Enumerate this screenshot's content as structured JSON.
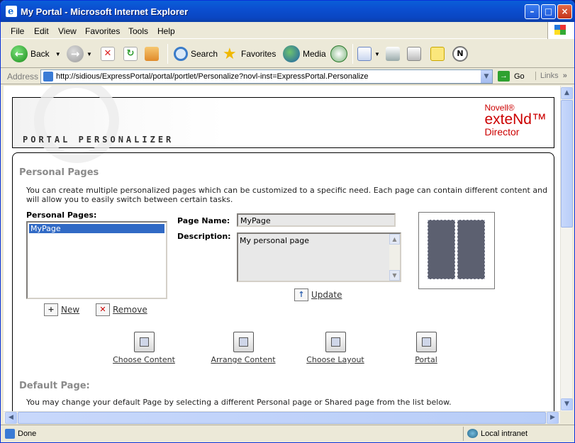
{
  "window": {
    "title": "My Portal - Microsoft Internet Explorer"
  },
  "menu": [
    "File",
    "Edit",
    "View",
    "Favorites",
    "Tools",
    "Help"
  ],
  "toolbar": {
    "back": "Back",
    "search": "Search",
    "favorites": "Favorites",
    "media": "Media"
  },
  "address": {
    "label": "Address",
    "url": "http://sidious/ExpressPortal/portal/portlet/Personalize?novl-inst=ExpressPortal.Personalize",
    "go": "Go",
    "links": "Links"
  },
  "banner": {
    "title": "PORTAL PERSONALIZER",
    "brand_line1": "Novell®",
    "brand_line2": "exteNd™",
    "brand_line3": "Director"
  },
  "personal": {
    "heading": "Personal Pages",
    "intro": "You can create multiple personalized pages which can be customized to a specific need. Each page can contain different content and will allow you to easily switch between certain tasks.",
    "list_label": "Personal Pages:",
    "pages": [
      "MyPage"
    ],
    "page_name_label": "Page Name:",
    "page_name_value": "MyPage",
    "description_label": "Description:",
    "description_value": "My personal page",
    "update": "Update",
    "new": "New",
    "remove": "Remove"
  },
  "actions": [
    "Choose Content",
    "Arrange Content",
    "Choose Layout",
    "Portal"
  ],
  "default_page": {
    "heading": "Default Page:",
    "intro": "You may change your default Page by selecting a different Personal page or Shared page from the list below."
  },
  "status": {
    "text": "Done",
    "zone": "Local intranet"
  }
}
